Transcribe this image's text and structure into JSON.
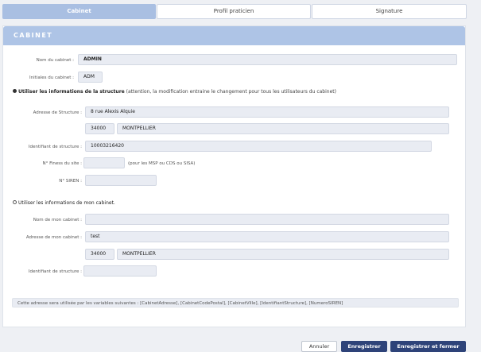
{
  "tabs": [
    {
      "label": "Cabinet",
      "active": true
    },
    {
      "label": "Profil praticien",
      "active": false
    },
    {
      "label": "Signature",
      "active": false
    }
  ],
  "card": {
    "title": "CABINET"
  },
  "cabinet": {
    "nom_label": "Nom du cabinet  :",
    "nom_value": "ADMIN",
    "initiales_label": "Initiales du cabinet  :",
    "initiales_value": "ADM"
  },
  "structure": {
    "radio_title": "Utiliser les informations de la structure",
    "radio_hint": "(attention, la modification entraine le changement pour tous les utilisateurs du cabinet)",
    "selected": true,
    "adresse_label": "Adresse de Structure  :",
    "adresse_value": "8 rue Alexis Alquie",
    "cp_value": "34000",
    "ville_value": "MONTPELLIER",
    "identifiant_label": "Identifiant de structure  :",
    "identifiant_value": "10003216420",
    "finess_label": "N° Finess du site  :",
    "finess_value": "",
    "finess_note": "(pour les MSP ou CDS ou SISA)",
    "siren_label": "N° SIREN  :",
    "siren_value": ""
  },
  "mon_cabinet": {
    "radio_title": "Utiliser les informations de mon cabinet.",
    "selected": false,
    "nom_label": "Nom de mon cabinet  :",
    "nom_value": "",
    "adresse_label": "Adresse de mon cabinet  :",
    "adresse_value": "test",
    "cp_value": "34000",
    "ville_value": "MONTPELLIER",
    "identifiant_label": "Identifiant de structure  :",
    "identifiant_value": ""
  },
  "variables_note": "Cette adresse sera utilisée par les variables suivantes : [CabinetAdresse], [CabinetCodePostal], [CabinetVille], [IdentifiantStructure], [NumeroSIREN]",
  "buttons": {
    "cancel": "Annuler",
    "save": "Enregistrer",
    "save_close": "Enregistrer et fermer"
  },
  "colors": {
    "header": "#aec4e6",
    "active_tab": "#a9bfe2",
    "primary_button": "#2e4379",
    "field_bg": "#e9ecf3"
  }
}
